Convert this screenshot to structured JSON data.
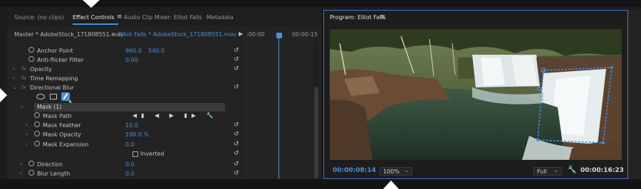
{
  "tabs": {
    "source": "Source: (no clips)",
    "effect_controls": "Effect Controls",
    "audio_mixer": "Audio Clip Mixer: Elliot Falls",
    "metadata": "Metadata"
  },
  "clip_header": {
    "master": "Master * AdobeStock_171808551.mov",
    "sequence_clip": "Elliot Falls * AdobeStock_171808551.mov",
    "timecode_start": ":00:00",
    "timecode_end": "00:00:15"
  },
  "properties": {
    "anchor_point": {
      "label": "Anchor Point",
      "x": "960.0",
      "y": "540.0"
    },
    "anti_flicker": {
      "label": "Anti-flicker Filter",
      "value": "0.00"
    },
    "opacity": {
      "label": "Opacity",
      "fx": "fx"
    },
    "time_remapping": {
      "label": "Time Remapping",
      "fx": "fx"
    },
    "directional_blur": {
      "label": "Directional Blur",
      "fx": "fx"
    },
    "mask": {
      "label": "Mask (1)"
    },
    "mask_path": {
      "label": "Mask Path"
    },
    "mask_feather": {
      "label": "Mask Feather",
      "value": "10.0"
    },
    "mask_opacity": {
      "label": "Mask Opacity",
      "value": "100.0 %"
    },
    "mask_expansion": {
      "label": "Mask Expansion",
      "value": "0.0"
    },
    "inverted": {
      "label": "Inverted"
    },
    "direction": {
      "label": "Direction",
      "value": "0.0"
    },
    "blur_length": {
      "label": "Blur Length",
      "value": "0.0"
    }
  },
  "program": {
    "title": "Program: Elliot Falls",
    "current_timecode": "00:00:08:14",
    "zoom": "100%",
    "quality": "Full",
    "duration": "00:00:16:23"
  },
  "icons": {
    "menu": "≡",
    "chevron_right": "›",
    "chevron_down": "⌄",
    "reset": "↺",
    "play": "▶",
    "wrench": "🔧",
    "dropdown": "⌄"
  },
  "colors": {
    "accent": "#4a90e0",
    "panel": "#232323",
    "border": "#3a78c8"
  }
}
